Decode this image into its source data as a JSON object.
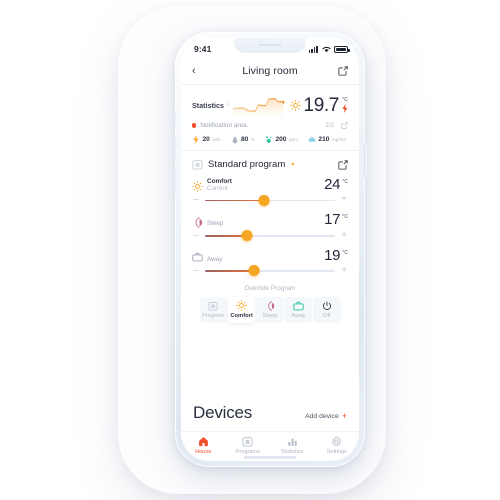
{
  "status_bar": {
    "time": "9:41",
    "signal_icon": "cellular-signal-icon",
    "wifi_icon": "wifi-icon",
    "battery_icon": "battery-icon"
  },
  "header": {
    "back_icon": "chevron-left-icon",
    "title": "Living room",
    "edit_icon": "edit-square-icon"
  },
  "statistics": {
    "label": "Statistics",
    "chevron": "›",
    "chart_icon": "sparkline-chart",
    "sun_icon": "sun-icon",
    "temperature": "19.7",
    "unit_celsius": "°C",
    "bolt_icon": "lightning-bolt-icon",
    "notification": {
      "dot_color": "#f1502f",
      "text": "Notification area.",
      "count": "2/2",
      "external_icon": "external-link-icon"
    },
    "metrics": [
      {
        "icon": "lightning-bolt-icon",
        "icon_color": "#f5a623",
        "value": "20",
        "unit": "kwh"
      },
      {
        "icon": "water-drop-icon",
        "icon_color": "#b9c2cf",
        "value": "80",
        "unit": "%"
      },
      {
        "icon": "co2-particles-icon",
        "icon_color": "#2ec4a0",
        "value": "200",
        "unit": "ppm"
      },
      {
        "icon": "cloud-icon",
        "icon_color": "#8ed2f0",
        "value": "210",
        "unit": "mg/m3"
      }
    ]
  },
  "program": {
    "icon": "calendar-program-icon",
    "name": "Standard program",
    "caret": "▾",
    "edit_icon": "edit-square-icon",
    "rows": [
      {
        "icon": "sun-icon",
        "icon_color": "#f5a623",
        "name": "Comfort",
        "sub": "Current",
        "value": "24",
        "unit": "°C",
        "minus": "–",
        "plus": "+",
        "percent": 45
      },
      {
        "icon": "moon-icon",
        "icon_color": "#c76a86",
        "name": "Sleep",
        "sub": "",
        "value": "17",
        "unit": "°C",
        "minus": "–",
        "plus": "+",
        "percent": 32
      },
      {
        "icon": "briefcase-icon",
        "icon_color": "#9aa4b2",
        "name": "Away",
        "sub": "",
        "value": "19",
        "unit": "°C",
        "minus": "–",
        "plus": "+",
        "percent": 38
      }
    ],
    "override_label": "Override Program",
    "modes": [
      {
        "icon": "calendar-program-icon",
        "label": "Program",
        "active": false,
        "color": "#c0c8d4"
      },
      {
        "icon": "sun-icon",
        "label": "Comfort",
        "active": true,
        "color": "#f5a623"
      },
      {
        "icon": "moon-icon",
        "label": "Sleep",
        "active": false,
        "color": "#c76a86"
      },
      {
        "icon": "briefcase-icon",
        "label": "Away",
        "active": false,
        "color": "#2ec4a0"
      },
      {
        "icon": "power-icon",
        "label": "Off",
        "active": false,
        "color": "#2d3342"
      }
    ]
  },
  "devices": {
    "title": "Devices",
    "add_label": "Add device",
    "add_plus": "+"
  },
  "tabbar": [
    {
      "icon": "house-icon",
      "label": "House",
      "active": true
    },
    {
      "icon": "programs-icon",
      "label": "Programs",
      "active": false
    },
    {
      "icon": "statistics-icon",
      "label": "Statistics",
      "active": false
    },
    {
      "icon": "settings-icon",
      "label": "Settings",
      "active": false
    }
  ],
  "colors": {
    "accent_orange": "#f5a623",
    "accent_red": "#f1502f",
    "accent_green": "#2ec4a0",
    "text_dark": "#23283a",
    "text_muted": "#aeb7c4"
  }
}
